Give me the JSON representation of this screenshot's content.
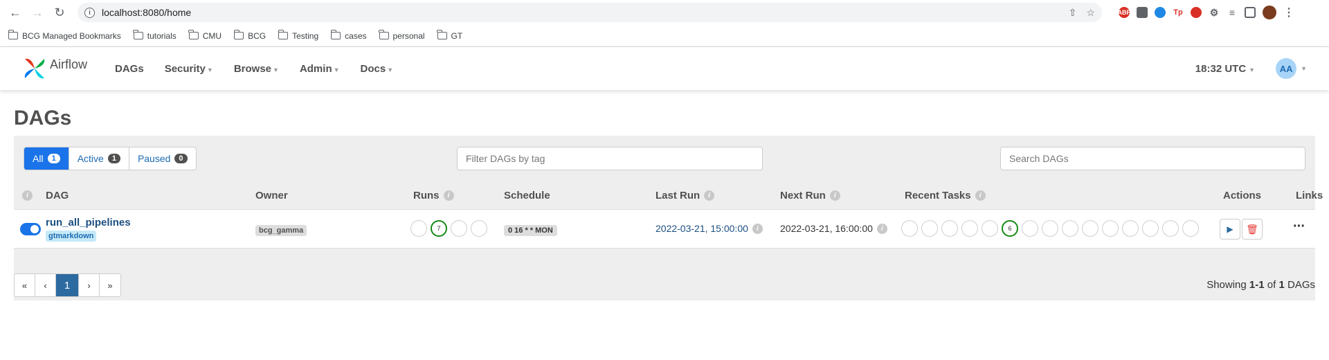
{
  "browser": {
    "url": "localhost:8080/home",
    "bookmarks": [
      "BCG Managed Bookmarks",
      "tutorials",
      "CMU",
      "BCG",
      "Testing",
      "cases",
      "personal",
      "GT"
    ],
    "extensions": [
      "ABP",
      "Tp"
    ]
  },
  "nav": {
    "brand": "Airflow",
    "menu": [
      "DAGs",
      "Security",
      "Browse",
      "Admin",
      "Docs"
    ],
    "time": "18:32 UTC",
    "user_initials": "AA"
  },
  "page": {
    "title": "DAGs",
    "filter_tabs": [
      {
        "label": "All",
        "count": "1"
      },
      {
        "label": "Active",
        "count": "1"
      },
      {
        "label": "Paused",
        "count": "0"
      }
    ],
    "tag_placeholder": "Filter DAGs by tag",
    "search_placeholder": "Search DAGs"
  },
  "table": {
    "headers": {
      "dag": "DAG",
      "owner": "Owner",
      "runs": "Runs",
      "schedule": "Schedule",
      "last_run": "Last Run",
      "next_run": "Next Run",
      "recent_tasks": "Recent Tasks",
      "actions": "Actions",
      "links": "Links"
    },
    "rows": [
      {
        "dag_id": "run_all_pipelines",
        "tag": "gtmarkdown",
        "owner": "bcg_gamma",
        "runs_success_count": "7",
        "schedule": "0 16 * * MON",
        "last_run": "2022-03-21, 15:00:00",
        "next_run": "2022-03-21, 16:00:00",
        "tasks_success_count": "6"
      }
    ]
  },
  "pagination": {
    "first": "«",
    "prev": "‹",
    "current": "1",
    "next": "›",
    "last": "»",
    "showing_prefix": "Showing ",
    "showing_range": "1-1",
    "showing_mid": " of ",
    "showing_total": "1",
    "showing_suffix": " DAGs"
  },
  "colors": {
    "primary": "#1a73e8",
    "success": "#148a14",
    "delete": "#e53935"
  }
}
